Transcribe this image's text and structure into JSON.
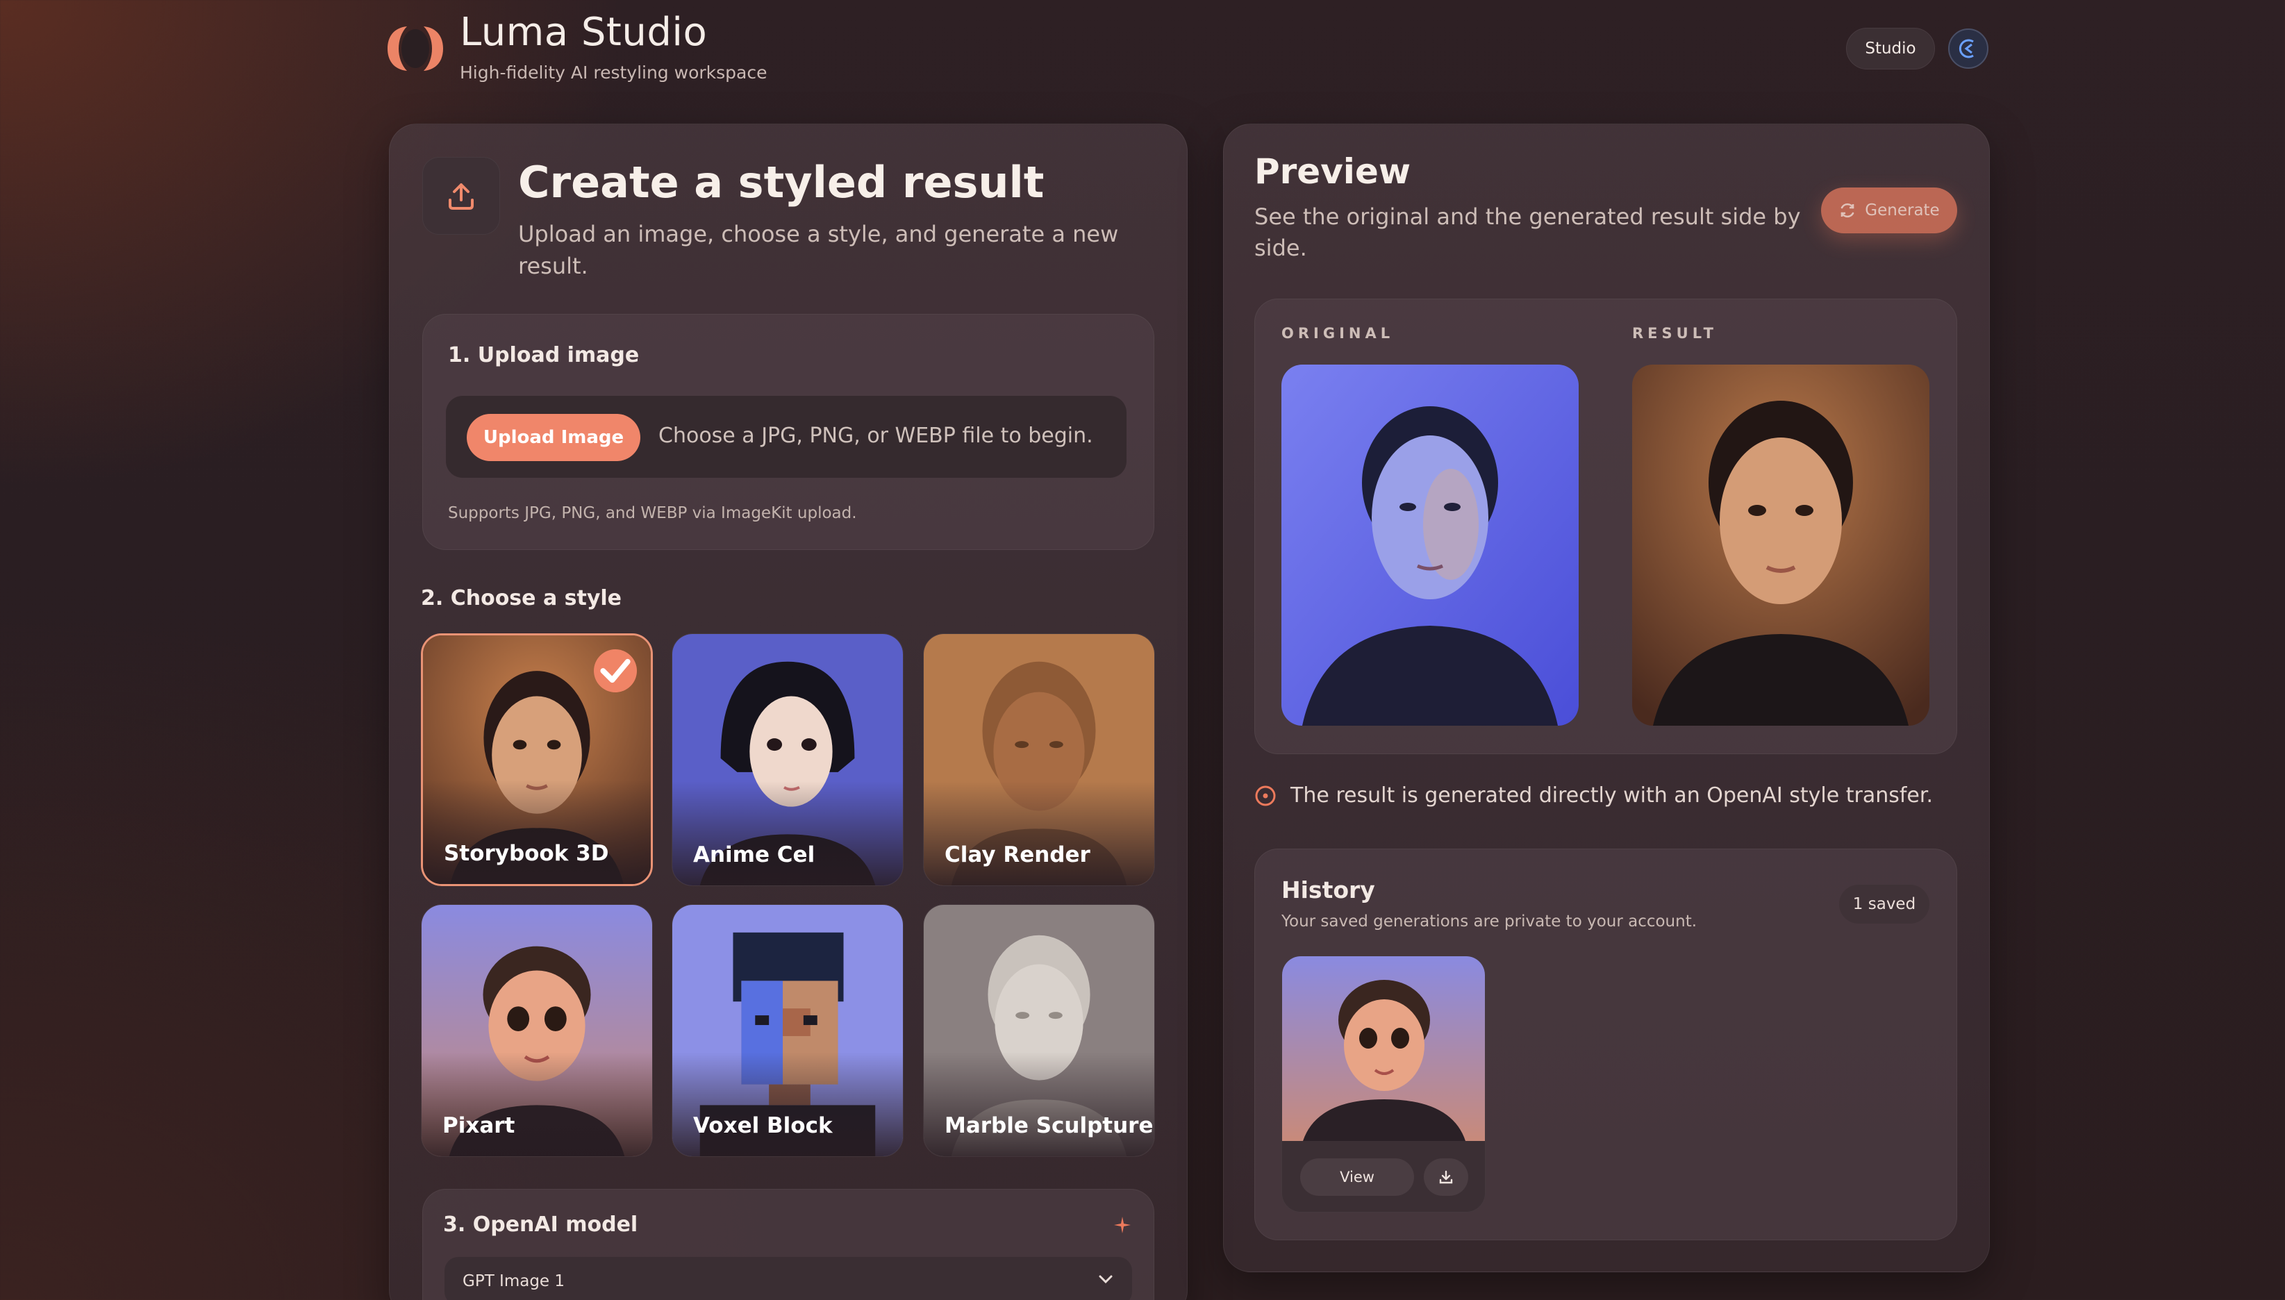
{
  "header": {
    "app_title": "Luma Studio",
    "app_subtitle": "High-fidelity AI restyling workspace",
    "studio_label": "Studio"
  },
  "create": {
    "title": "Create a styled result",
    "subtitle": "Upload an image, choose a style, and generate a new result."
  },
  "upload": {
    "step_label": "1. Upload image",
    "button_label": "Upload Image",
    "hint": "Choose a JPG, PNG, or WEBP file to begin.",
    "note": "Supports JPG, PNG, and WEBP via ImageKit upload."
  },
  "styles": {
    "step_label": "2. Choose a style",
    "items": [
      {
        "label": "Storybook 3D",
        "selected": true
      },
      {
        "label": "Anime Cel",
        "selected": false
      },
      {
        "label": "Clay Render",
        "selected": false
      },
      {
        "label": "Pixart",
        "selected": false
      },
      {
        "label": "Voxel Block",
        "selected": false
      },
      {
        "label": "Marble Sculpture",
        "selected": false
      }
    ]
  },
  "model": {
    "step_label": "3. OpenAI model",
    "selected": "GPT Image 1"
  },
  "preview": {
    "title": "Preview",
    "subtitle": "See the original and the generated result side by side.",
    "generate_label": "Generate",
    "original_caption": "ORIGINAL",
    "result_caption": "RESULT",
    "info_text": "The result is generated directly with an OpenAI style transfer."
  },
  "history": {
    "title": "History",
    "subtitle": "Your saved generations are private to your account.",
    "saved_count": "1 saved",
    "view_label": "View"
  },
  "colors": {
    "accent": "#f0866a",
    "background": "#2b1e22",
    "panel": "#3e3036"
  }
}
